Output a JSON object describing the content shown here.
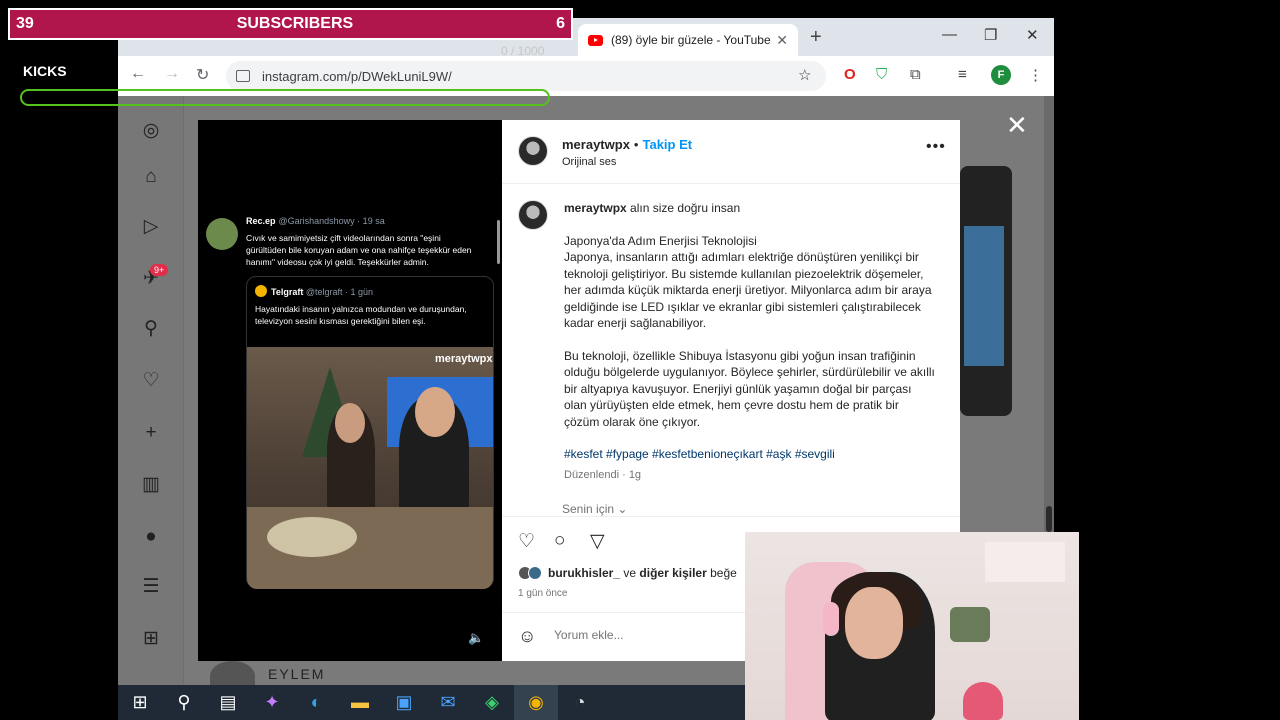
{
  "overlay": {
    "subscribers_left": "39",
    "subscribers_label": "SUBSCRIBERS",
    "subscribers_right": "6",
    "kicks_label": "KICKS",
    "char_count": "0 / 1000"
  },
  "browser": {
    "active_tab_title": "(89) öyle bir güzele - YouTube",
    "url": "instagram.com/p/DWekLuniL9W/",
    "profile_initial": "F"
  },
  "post": {
    "username": "meraytwpx",
    "follow_label": "Takip Et",
    "audio": "Orijinal ses",
    "caption_intro": "alın size doğru insan",
    "caption_para1": "Japonya'da Adım Enerjisi Teknolojisi\nJaponya, insanların attığı adımları elektriğe dönüştüren yenilikçi bir teknoloji geliştiriyor. Bu sistemde kullanılan piezoelektrik döşemeler, her adımda küçük miktarda enerji üretiyor. Milyonlarca adım bir araya geldiğinde ise LED ışıklar ve ekranlar gibi sistemleri çalıştırabilecek kadar enerji sağlanabiliyor.",
    "caption_para2": "Bu teknoloji, özellikle Shibuya İstasyonu gibi yoğun insan trafiğinin olduğu bölgelerde uygulanıyor. Böylece şehirler, sürdürülebilir ve akıllı bir altyapıya kavuşuyor. Enerjiyi günlük yaşamın doğal bir parçası olan yürüyüşten elde etmek, hem çevre dostu hem de pratik bir çözüm olarak öne çıkıyor.",
    "hashtags": "#kesfet #fypage #kesfetbenioneçıkart #aşk #sevgili",
    "edited": "Düzenlendi · 1g",
    "for_you": "Senin için",
    "likes_user": "burukhisler_",
    "likes_mid": "ve",
    "likes_others": "diğer kişiler",
    "likes_tail": "beğe",
    "time_ago": "1 gün önce",
    "comment_placeholder": "Yorum ekle..."
  },
  "media": {
    "tweet_name": "Rec.ep",
    "tweet_handle": "@Garishandshowy · 19 sa",
    "tweet_text": "Cıvık ve samimiyetsiz çift videolarından sonra \"eşini gürültüden bile koruyan adam ve ona nahifçe teşekkür eden hanımı\" videosu çok iyi geldi. Teşekkürler admin.",
    "quote_name": "Telgraft",
    "quote_handle": "@telgraft · 1 gün",
    "quote_text": "Hayatındaki insanın yalnızca modundan ve duruşundan, televizyon sesini kısması gerektiğini bilen eşi.",
    "watermark": "meraytwpx"
  },
  "page_bg": {
    "eylem_label": "EYLEM",
    "notification_badge": "9+"
  },
  "colors": {
    "subscribers_bar": "#b0154b",
    "kicks_bar": "#55c21b",
    "follow": "#0095f6",
    "hashtag": "#00376b"
  }
}
